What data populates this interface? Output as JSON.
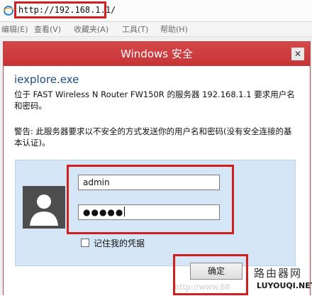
{
  "browser": {
    "url": "http://192.168.1.1/",
    "menu": [
      "编辑(E)",
      "查看(V)",
      "收藏夹(A)",
      "工具(T)",
      "帮助(H)"
    ]
  },
  "dialog": {
    "title": "Windows 安全",
    "close_symbol": "✕",
    "app_name": "iexplore.exe",
    "description": "位于 FAST Wireless N Router FW150R 的服务器 192.168.1.1 要求用户名和密码。",
    "warning": "警告: 此服务器要求以不安全的方式发送你的用户名和密码(没有安全连接的基本认证)。",
    "username_value": "admin",
    "password_mask": "●●●●●",
    "remember_label": "记住我的凭据",
    "ok_label": "确定"
  },
  "watermark": {
    "title": "路由器网",
    "site": "LUYOUQI.NET",
    "url": "http://www.88"
  }
}
